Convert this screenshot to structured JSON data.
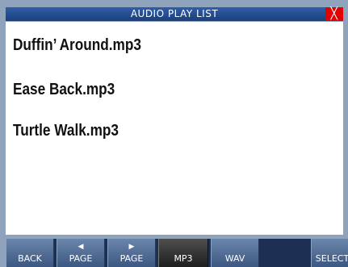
{
  "window": {
    "title": "AUDIO PLAY LIST",
    "close_label": "╳"
  },
  "playlist": {
    "items": [
      {
        "label": "Duffin’ Around.mp3"
      },
      {
        "label": "Ease Back.mp3"
      },
      {
        "label": "Turtle Walk.mp3"
      }
    ]
  },
  "toolbar": {
    "back_label": "BACK",
    "page_prev_label": "PAGE",
    "page_prev_arrow": "◀",
    "page_next_label": "PAGE",
    "page_next_arrow": "▶",
    "mp3_label": "MP3",
    "wav_label": "WAV",
    "select_label": "SELECT",
    "active_tab": "MP3"
  },
  "colors": {
    "title_bar": "#2f5ea8",
    "close_button": "#e30000",
    "toolbar_button": "#5a7398",
    "active_button": "#2e2e2e"
  }
}
